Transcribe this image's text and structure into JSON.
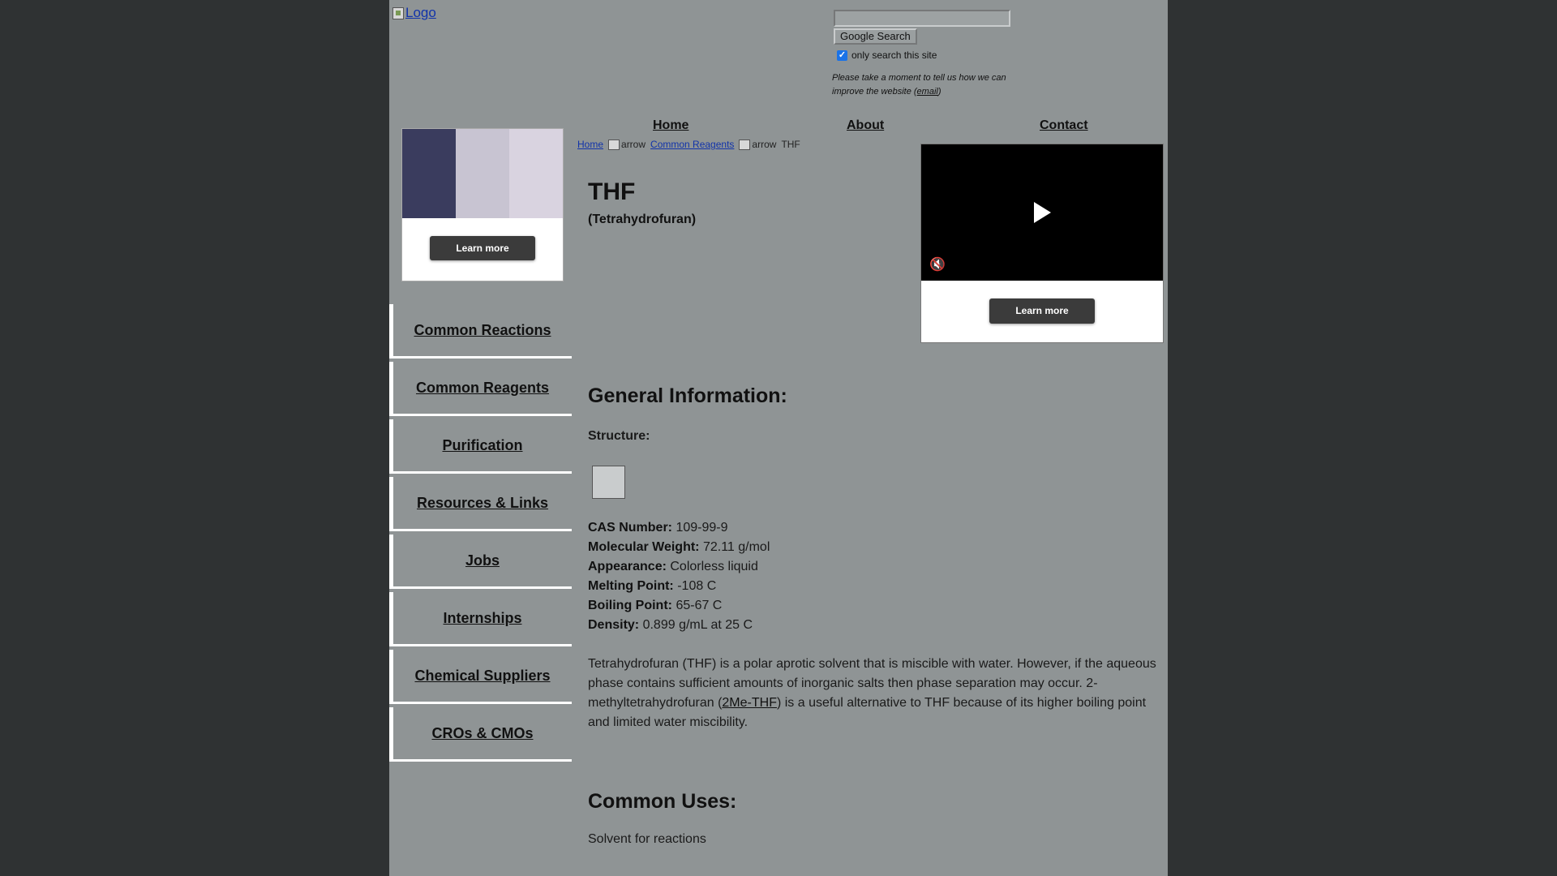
{
  "header": {
    "logo_alt": "Logo",
    "search_placeholder": "",
    "search_button": "Google Search",
    "search_checkbox_label": "only search this site",
    "feedback_text_1": "Please take a moment to tell us how we can improve the website (",
    "feedback_link": "email",
    "feedback_text_2": ")"
  },
  "nav": {
    "home": "Home",
    "about": "About",
    "contact": "Contact"
  },
  "breadcrumb": {
    "home": "Home",
    "arrow_alt": "arrow",
    "reagents": "Common Reagents",
    "current": "THF"
  },
  "ads": {
    "learn_more": "Learn more",
    "image_colors": [
      "#3a3c5e",
      "#c8c4d2",
      "#d9d3e0"
    ],
    "mute_icon": "muted-speaker-icon",
    "play_icon": "play-icon"
  },
  "sidebar": {
    "items": [
      {
        "label": "Common Reactions"
      },
      {
        "label": "Common Reagents"
      },
      {
        "label": "Purification"
      },
      {
        "label": "Resources & Links"
      },
      {
        "label": "Jobs"
      },
      {
        "label": "Internships"
      },
      {
        "label": "Chemical Suppliers"
      },
      {
        "label": "CROs & CMOs"
      }
    ]
  },
  "content": {
    "title": "THF",
    "subtitle": "(Tetrahydrofuran)",
    "general_heading": "General Information:",
    "structure_label": "Structure:",
    "properties": [
      {
        "label": "CAS Number:",
        "value": "109-99-9"
      },
      {
        "label": "Molecular Weight:",
        "value": "72.11 g/mol"
      },
      {
        "label": "Appearance:",
        "value": "Colorless liquid"
      },
      {
        "label": "Melting Point:",
        "value": "-108 C"
      },
      {
        "label": "Boiling Point:",
        "value": "65-67 C"
      },
      {
        "label": "Density:",
        "value": "0.899 g/mL at 25 C"
      }
    ],
    "description_1": "Tetrahydrofuran (THF) is a polar aprotic solvent that is miscible with water. However, if the aqueous phase contains sufficient amounts of inorganic salts then phase separation may occur. 2-methyltetrahydrofuran (",
    "description_link": "2Me-THF",
    "description_2": ") is a useful alternative to THF because of its higher boiling point and limited water miscibility.",
    "uses_heading": "Common Uses:",
    "uses_text": "Solvent for reactions"
  }
}
